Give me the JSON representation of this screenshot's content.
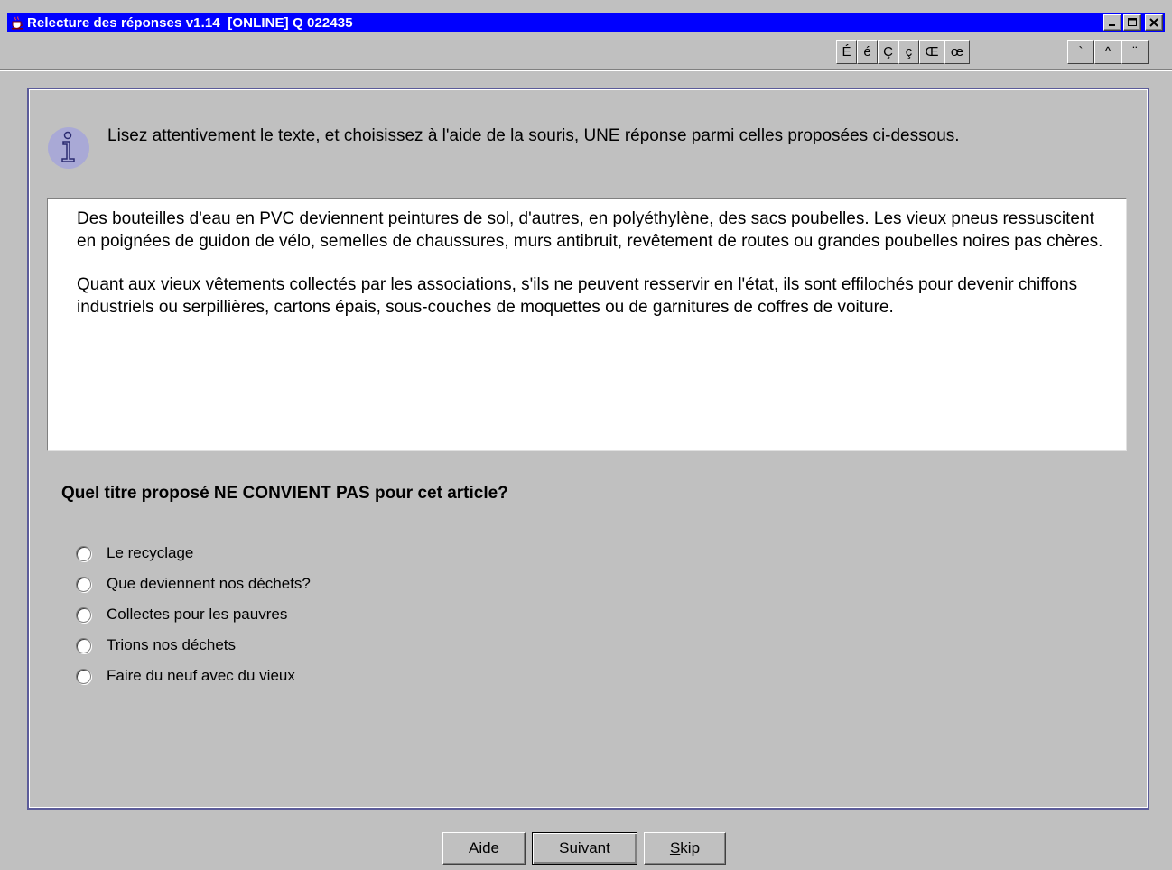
{
  "window": {
    "title": "Relecture des réponses v1.14  [ONLINE] Q 022435",
    "minimize_label": "_",
    "maximize_label": "□",
    "close_label": "✕"
  },
  "charbar": {
    "group1": [
      "É",
      "é",
      "Ç",
      "ç",
      "Œ",
      "œ"
    ],
    "group2": [
      "`",
      "^",
      "¨"
    ]
  },
  "instruction": "Lisez attentivement le texte, et choisissez à l'aide de la souris, UNE réponse parmi celles proposées ci-dessous.",
  "article": {
    "paragraphs": [
      "Des bouteilles d'eau en PVC deviennent peintures de sol, d'autres, en polyéthylène, des sacs poubelles. Les vieux pneus ressuscitent en poignées de guidon de vélo, semelles de chaussures, murs antibruit, revêtement de routes ou grandes poubelles noires pas chères.",
      "Quant aux vieux vêtements collectés par les associations, s'ils ne peuvent resservir en l'état, ils sont effilochés pour devenir chiffons industriels ou serpillières, cartons épais, sous-couches de moquettes ou de garnitures de coffres de voiture."
    ]
  },
  "question": "Quel titre proposé NE CONVIENT PAS pour cet article?",
  "options": [
    "Le recyclage",
    "Que deviennent nos déchets?",
    "Collectes pour les pauvres",
    "Trions nos déchets",
    "Faire du neuf avec du vieux"
  ],
  "buttons": {
    "help": "Aide",
    "next": "Suivant",
    "skip_prefix": "S",
    "skip_rest": "kip"
  },
  "colors": {
    "titlebar": "#0000ff",
    "background": "#c0c0c0",
    "panel_border": "#5c5c9a",
    "info_icon": "#a9a9d6"
  }
}
